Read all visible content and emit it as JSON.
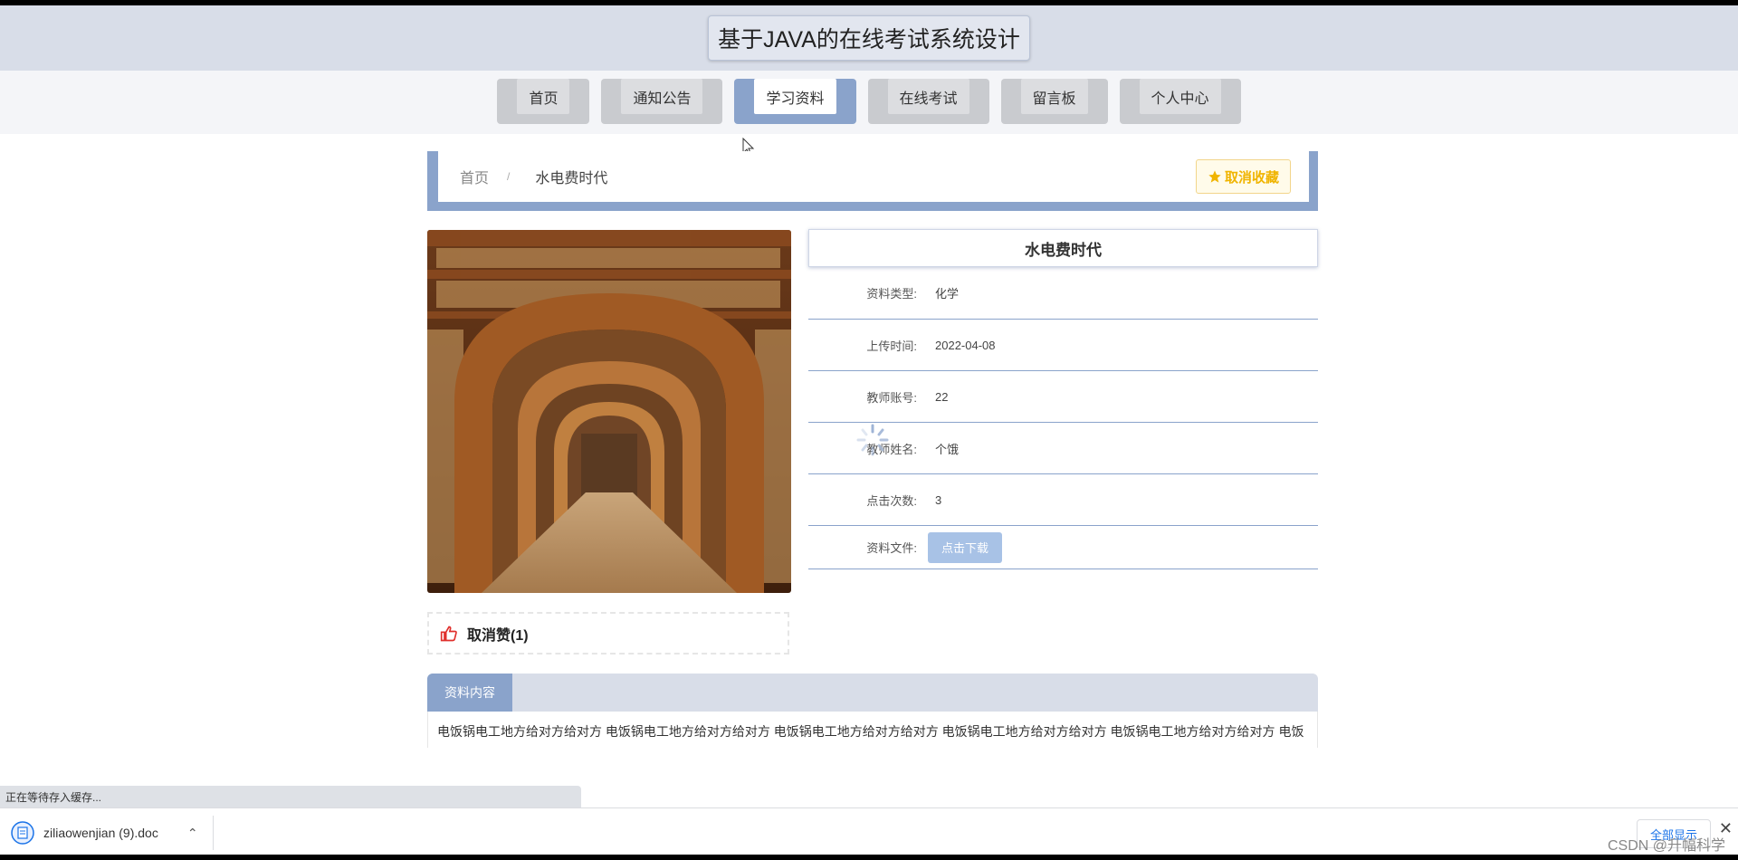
{
  "header": {
    "title": "基于JAVA的在线考试系统设计"
  },
  "nav": {
    "items": [
      {
        "label": "首页"
      },
      {
        "label": "通知公告"
      },
      {
        "label": "学习资料"
      },
      {
        "label": "在线考试"
      },
      {
        "label": "留言板"
      },
      {
        "label": "个人中心"
      }
    ],
    "active": "学习资料"
  },
  "breadcrumb": {
    "home": "首页",
    "separator": "/",
    "current": "水电费时代"
  },
  "favorite_button": {
    "label": "取消收藏",
    "color": "#f0b400"
  },
  "like": {
    "label": "取消赞(1)",
    "icon": "thumbs-up-icon",
    "color": "#e0302c"
  },
  "info": {
    "title": "水电费时代",
    "rows": [
      {
        "label": "资料类型:",
        "value": "化学"
      },
      {
        "label": "上传时间:",
        "value": "2022-04-08"
      },
      {
        "label": "教师账号:",
        "value": "22"
      },
      {
        "label": "教师姓名:",
        "value": "个饿"
      },
      {
        "label": "点击次数:",
        "value": "3"
      }
    ],
    "file_label": "资料文件:",
    "download_label": "点击下载"
  },
  "content": {
    "tab_label": "资料内容",
    "text": "电饭锅电工地方给对方给对方 电饭锅电工地方给对方给对方 电饭锅电工地方给对方给对方 电饭锅电工地方给对方给对方 电饭锅电工地方给对方给对方 电饭"
  },
  "status_bar": {
    "text": "正在等待存入缓存..."
  },
  "download_shelf": {
    "file_name": "ziliaowenjian (9).doc",
    "show_all": "全部显示"
  },
  "watermark": "CSDN @升幅科学",
  "colors": {
    "accent": "#8aa3cb",
    "header_bg": "#d8dde8"
  }
}
